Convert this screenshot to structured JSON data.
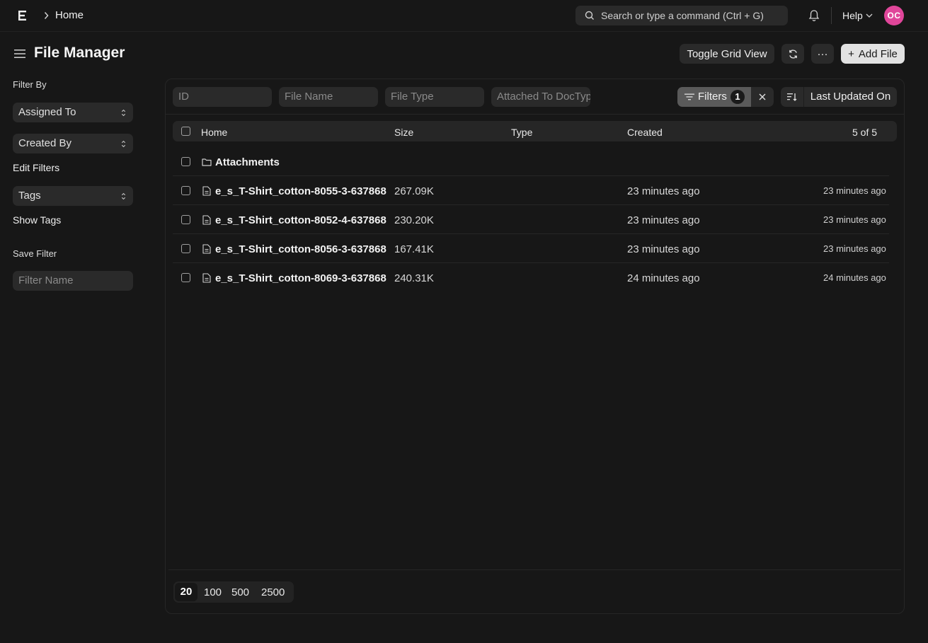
{
  "navbar": {
    "breadcrumb": "Home",
    "search_placeholder": "Search or type a command (Ctrl + G)",
    "help_label": "Help",
    "avatar_initials": "OC",
    "avatar_color": "#e0469a"
  },
  "page": {
    "title": "File Manager"
  },
  "toolbar": {
    "toggle_grid_label": "Toggle Grid View",
    "refresh_icon": "refresh-icon",
    "more_label": "···",
    "add_file_plus": "+",
    "add_file_label": "Add File"
  },
  "sidebar": {
    "filter_by_label": "Filter By",
    "assigned_to": "Assigned To",
    "created_by": "Created By",
    "edit_filters": "Edit Filters",
    "tags": "Tags",
    "show_tags": "Show Tags",
    "save_filter_label": "Save Filter",
    "filter_name_placeholder": "Filter Name"
  },
  "filters": {
    "id_placeholder": "ID",
    "file_name_placeholder": "File Name",
    "file_type_placeholder": "File Type",
    "attached_placeholder": "Attached To DocType",
    "filters_label": "Filters",
    "filters_count": "1",
    "sort_field": "Last Updated On"
  },
  "table": {
    "headers": {
      "name": "Home",
      "size": "Size",
      "type": "Type",
      "created": "Created",
      "count": "5 of 5"
    },
    "rows": [
      {
        "kind": "folder",
        "name": "Attachments",
        "size": "",
        "type": "",
        "created": "",
        "modified": ""
      },
      {
        "kind": "file",
        "name": "e_s_T-Shirt_cotton-8055-3-637868",
        "size": "267.09K",
        "type": "",
        "created": "23 minutes ago",
        "modified": "23 minutes ago"
      },
      {
        "kind": "file",
        "name": "e_s_T-Shirt_cotton-8052-4-637868",
        "size": "230.20K",
        "type": "",
        "created": "23 minutes ago",
        "modified": "23 minutes ago"
      },
      {
        "kind": "file",
        "name": "e_s_T-Shirt_cotton-8056-3-637868",
        "size": "167.41K",
        "type": "",
        "created": "23 minutes ago",
        "modified": "23 minutes ago"
      },
      {
        "kind": "file",
        "name": "e_s_T-Shirt_cotton-8069-3-637868",
        "size": "240.31K",
        "type": "",
        "created": "24 minutes ago",
        "modified": "24 minutes ago"
      }
    ]
  },
  "pagination": {
    "options": [
      "20",
      "100",
      "500",
      "2500"
    ],
    "selected": "20"
  }
}
